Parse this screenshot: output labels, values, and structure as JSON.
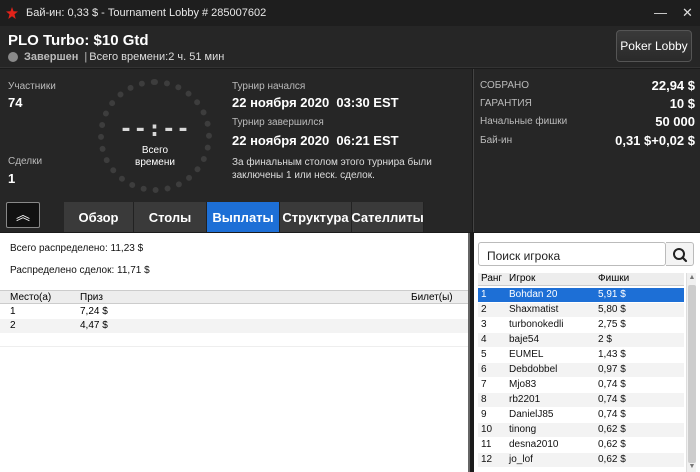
{
  "window": {
    "title": "Бай-ин: 0,33 $ - Tournament Lobby # 285007602",
    "controls": {
      "minimize": "—",
      "close": "✕"
    }
  },
  "header": {
    "tournament_name": "PLO Turbo: $10 Gtd",
    "status": "Завершен",
    "separator": "|",
    "duration": "Всего времени:2 ч. 51 мин",
    "poker_lobby_button": "Poker Lobby"
  },
  "info": {
    "participants_label": "Участники",
    "participants_value": "74",
    "deals_label": "Сделки",
    "deals_value": "1",
    "clock_display": "--:--",
    "clock_label": "Всего времени",
    "started_label": "Турнир начался",
    "started_value": "22 ноября 2020  03:30 EST",
    "ended_label": "Турнир завершился",
    "ended_value": "22 ноября 2020  06:21 EST",
    "note": "За финальным столом этого турнира были заключены 1 или неск. сделок."
  },
  "stats": [
    {
      "label": "СОБРАНО",
      "value": "22,94 $"
    },
    {
      "label": "ГАРАНТИЯ",
      "value": "10 $"
    },
    {
      "label": "Начальные фишки",
      "value": "50 000"
    },
    {
      "label": "Бай-ин",
      "value": "0,31 $+0,02 $"
    }
  ],
  "collapse_button": "︽",
  "tabs": [
    {
      "label": "Обзор",
      "active": false
    },
    {
      "label": "Столы",
      "active": false
    },
    {
      "label": "Выплаты",
      "active": true
    },
    {
      "label": "Структура",
      "active": false
    },
    {
      "label": "Сателлиты",
      "active": false
    }
  ],
  "payouts": {
    "total_distributed": "Всего распределено: 11,23 $",
    "deals_distributed": "Распределено сделок: 11,71 $",
    "columns": {
      "place": "Место(а)",
      "prize": "Приз",
      "ticket": "Билет(ы)"
    },
    "rows": [
      {
        "place": "1",
        "prize": "7,24 $",
        "ticket": ""
      },
      {
        "place": "2",
        "prize": "4,47 $",
        "ticket": ""
      }
    ]
  },
  "players": {
    "search_placeholder": "Поиск игрока",
    "columns": {
      "rank": "Ранг",
      "player": "Игрок",
      "chips": "Фишки"
    },
    "rows": [
      {
        "rank": "1",
        "name": "Bohdan 20",
        "chips": "5,91 $"
      },
      {
        "rank": "2",
        "name": "Shaxmatist",
        "chips": "5,80 $"
      },
      {
        "rank": "3",
        "name": "turbonokedli",
        "chips": "2,75 $"
      },
      {
        "rank": "4",
        "name": "baje54",
        "chips": "2 $"
      },
      {
        "rank": "5",
        "name": "EUMEL",
        "chips": "1,43 $"
      },
      {
        "rank": "6",
        "name": "Debdobbel",
        "chips": "0,97 $"
      },
      {
        "rank": "7",
        "name": "Mjo83",
        "chips": "0,74 $"
      },
      {
        "rank": "8",
        "name": "rb2201",
        "chips": "0,74 $"
      },
      {
        "rank": "9",
        "name": "DanielJ85",
        "chips": "0,74 $"
      },
      {
        "rank": "10",
        "name": "tinong",
        "chips": "0,62 $"
      },
      {
        "rank": "11",
        "name": "desna2010",
        "chips": "0,62 $"
      },
      {
        "rank": "12",
        "name": "jo_lof",
        "chips": "0,62 $"
      }
    ],
    "selected_rank": "1"
  },
  "colors": {
    "accent": "#1d6fd6",
    "logo": "#e2231a"
  }
}
